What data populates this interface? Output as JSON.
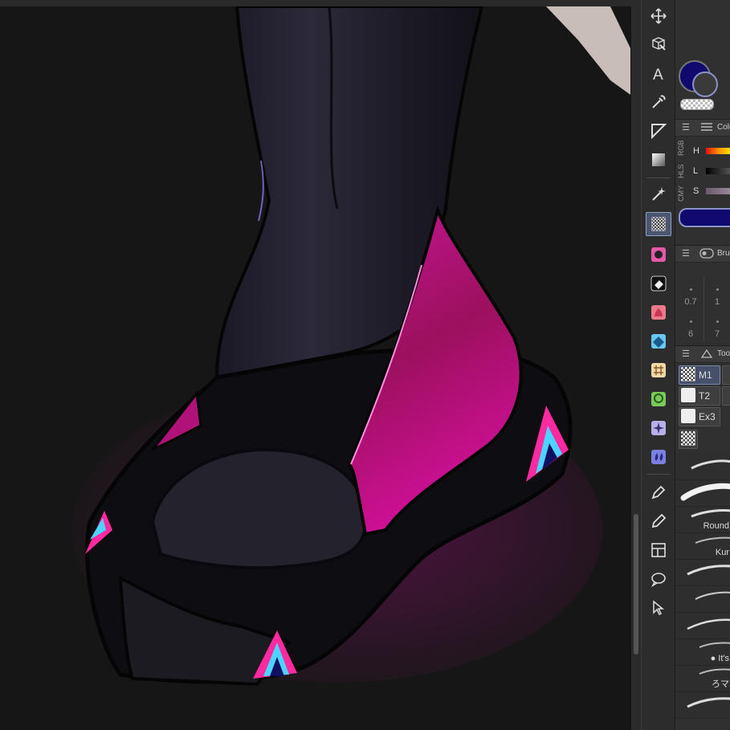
{
  "toolbar": {
    "icons": [
      "move-icon",
      "object-select-icon",
      "text-icon",
      "eyedropper-icon",
      "ruler-icon",
      "gradient-icon",
      "magic-wand-icon",
      "transparent-brush-icon",
      "blur-icon",
      "eraser-icon",
      "fill-icon",
      "gradient-fill-icon",
      "grid-icon",
      "lasso-fill-icon",
      "sparkle-icon",
      "water-drop-icon",
      "pen-icon",
      "pencil-icon",
      "frame-icon",
      "speech-balloon-icon",
      "select-arrow-icon"
    ]
  },
  "colors": {
    "main": "#100a6e",
    "sub": "#3a3a3a",
    "accent_magenta": "#c0107a"
  },
  "color_panel": {
    "title": "Colo",
    "tabs": [
      "RGB",
      "HLS",
      "CMY"
    ],
    "sliders": [
      "H",
      "L",
      "S"
    ]
  },
  "brush_size_panel": {
    "title": "Brus",
    "sizes": [
      "0.7",
      "1",
      "6",
      "7"
    ]
  },
  "tool_property_panel": {
    "title": "Too",
    "sub_tools": [
      "M1",
      "T2",
      "Ex3"
    ]
  },
  "brush_list": {
    "names": [
      "Round",
      "Kur",
      "It's",
      "ろマ"
    ]
  }
}
